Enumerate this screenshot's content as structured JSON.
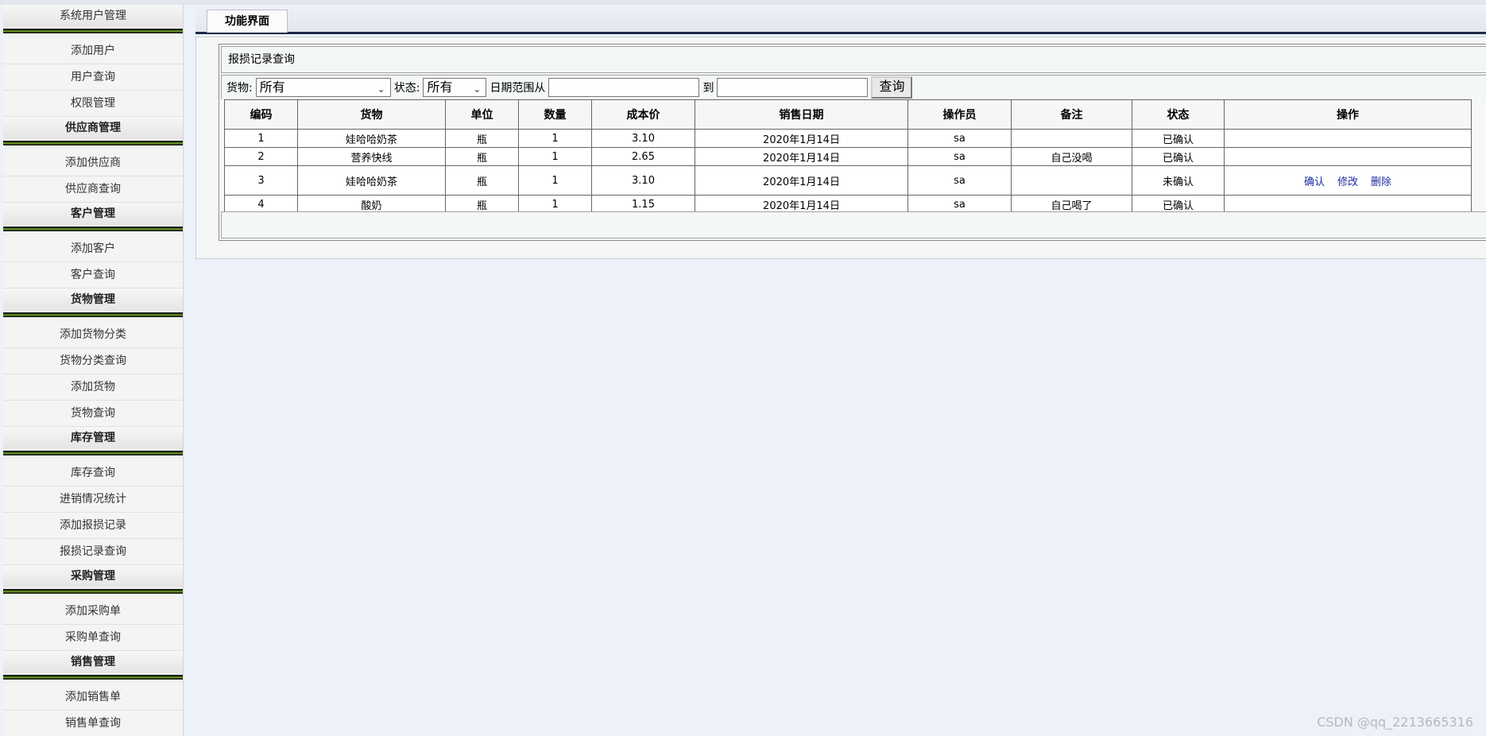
{
  "sidebar": {
    "groups": [
      {
        "title": "系统用户管理",
        "items": [
          "添加用户",
          "用户查询",
          "权限管理"
        ]
      },
      {
        "title": "供应商管理",
        "items": [
          "添加供应商",
          "供应商查询"
        ]
      },
      {
        "title": "客户管理",
        "items": [
          "添加客户",
          "客户查询"
        ]
      },
      {
        "title": "货物管理",
        "items": [
          "添加货物分类",
          "货物分类查询",
          "添加货物",
          "货物查询"
        ]
      },
      {
        "title": "库存管理",
        "items": [
          "库存查询",
          "进销情况统计",
          "添加报损记录",
          "报损记录查询"
        ]
      },
      {
        "title": "采购管理",
        "items": [
          "添加采购单",
          "采购单查询"
        ]
      },
      {
        "title": "销售管理",
        "items": [
          "添加销售单",
          "销售单查询"
        ]
      }
    ]
  },
  "tab": {
    "label": "功能界面"
  },
  "panel": {
    "title": "报损记录查询"
  },
  "filter": {
    "goods_label": "货物:",
    "goods_value": "所有",
    "status_label": "状态:",
    "status_value": "所有",
    "date_label": "日期范围从",
    "date_to_label": "到",
    "date_from_value": "",
    "date_to_value": "",
    "query_button": "查询"
  },
  "table": {
    "headers": [
      "编码",
      "货物",
      "单位",
      "数量",
      "成本价",
      "销售日期",
      "操作员",
      "备注",
      "状态",
      "操作"
    ],
    "rows": [
      {
        "cells": [
          "1",
          "娃哈哈奶茶",
          "瓶",
          "1",
          "3.10",
          "2020年1月14日",
          "sa",
          "",
          "已确认"
        ],
        "actions": []
      },
      {
        "cells": [
          "2",
          "营养快线",
          "瓶",
          "1",
          "2.65",
          "2020年1月14日",
          "sa",
          "自己没喝",
          "已确认"
        ],
        "actions": []
      },
      {
        "cells": [
          "3",
          "娃哈哈奶茶",
          "瓶",
          "1",
          "3.10",
          "2020年1月14日",
          "sa",
          "",
          "未确认"
        ],
        "actions": [
          "确认",
          "修改",
          "删除"
        ]
      },
      {
        "cells": [
          "4",
          "酸奶",
          "瓶",
          "1",
          "1.15",
          "2020年1月14日",
          "sa",
          "自己喝了",
          "已确认"
        ],
        "actions": []
      }
    ]
  },
  "watermark": "CSDN @qq_2213665316",
  "icons": {
    "select_arrow": "chevron-down-icon"
  }
}
